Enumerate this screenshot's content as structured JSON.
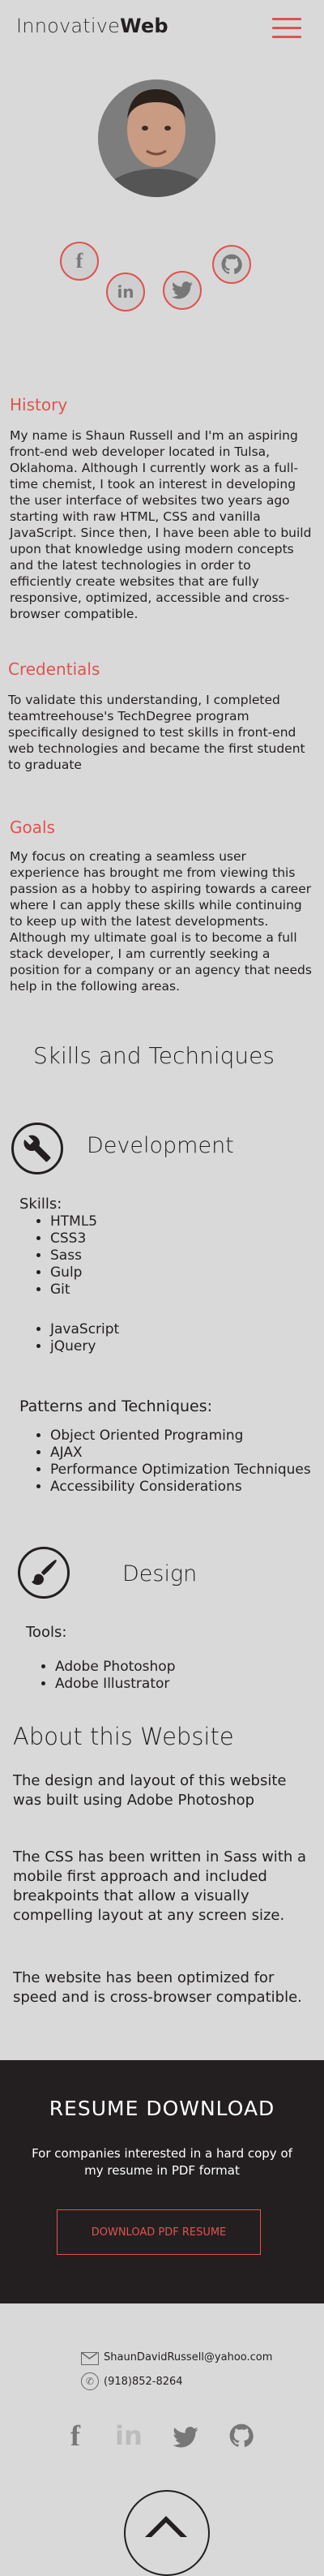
{
  "header": {
    "brand_light": "Innovative",
    "brand_bold": "Web"
  },
  "history": {
    "heading": "History",
    "text": "My name is Shaun Russell and I'm an aspiring front-end web developer located in Tulsa, Oklahoma. Although I currently work as a full-time chemist, I took an interest in developing the user interface of websites two years ago starting with raw HTML, CSS and vanilla JavaScript.  Since then, I have been able to build upon that knowledge using modern concepts and the latest technologies in order to efficiently create websites that are fully responsive, optimized, accessible and cross-browser compatible."
  },
  "credentials": {
    "heading": "Credentials",
    "text": "To validate this understanding, I completed teamtreehouse's TechDegree program specifically designed to test skills in front-end web technologies and became the first student to graduate"
  },
  "goals": {
    "heading": "Goals",
    "text": "My focus on creating a seamless user experience has brought me from viewing this passion as a hobby to aspiring towards a career where I can apply these skills while continuing to keep up with the latest developments. Although my ultimate goal is to become a full stack developer, I am currently seeking a position for a company or an agency that needs help in the following areas."
  },
  "skills": {
    "title": "Skills and Techniques",
    "development": {
      "title": "Development",
      "skills_label": "Skills:",
      "skills": [
        "HTML5",
        "CSS3",
        "Sass",
        "Gulp",
        "Git"
      ],
      "skills2": [
        "JavaScript",
        "jQuery"
      ],
      "patterns_label": "Patterns and Techniques:",
      "patterns": [
        "Object Oriented Programing",
        "AJAX",
        "Performance Optimization Techniques",
        "Accessibility Considerations"
      ]
    },
    "design": {
      "title": "Design",
      "tools_label": "Tools:",
      "tools": [
        "Adobe Photoshop",
        "Adobe Illustrator"
      ]
    }
  },
  "about": {
    "title": "About this Website",
    "p1": "The design and layout of this website was built using Adobe Photoshop",
    "p2": "The CSS has been written in Sass with a mobile first approach and included breakpoints that allow a visually compelling layout at any screen size.",
    "p3": "The website has been optimized for speed and is cross-browser compatible."
  },
  "resume": {
    "title": "RESUME DOWNLOAD",
    "text": "For companies interested in a hard copy of my resume in PDF format",
    "button": "DOWNLOAD PDF RESUME"
  },
  "contact": {
    "email": "ShaunDavidRussell@yahoo.com",
    "phone": "(918)852-8264"
  },
  "colors": {
    "accent": "#e0534f",
    "dark": "#231f20",
    "background": "#d9d9d9"
  },
  "icons": [
    "menu-icon",
    "facebook-icon",
    "linkedin-icon",
    "twitter-icon",
    "github-icon",
    "wrench-icon",
    "brush-icon",
    "mail-icon",
    "phone-icon",
    "chevron-up-icon"
  ]
}
